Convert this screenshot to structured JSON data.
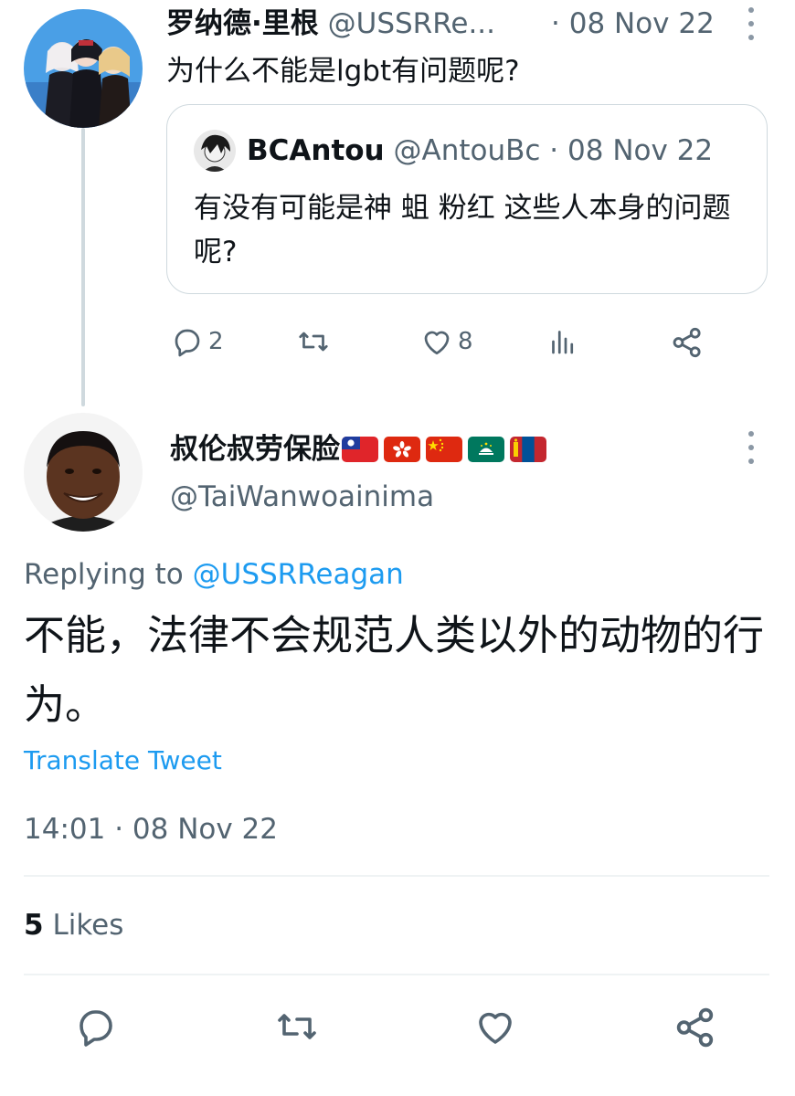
{
  "parent_tweet": {
    "display_name": "罗纳德·里根",
    "handle": "@USSRRe...",
    "dot": "·",
    "date": "08 Nov 22",
    "text": "为什么不能是lgbt有问题呢?",
    "avatar_icon": "anime-group-avatar",
    "quote": {
      "display_name": "BCAntou",
      "handle": "@AntouBc",
      "dot": "·",
      "date": "08 Nov 22",
      "text": "有没有可能是神 蛆 粉红 这些人本身的问题呢?"
    },
    "actions": {
      "reply_count": "2",
      "retweet_count": "",
      "like_count": "8"
    }
  },
  "main_tweet": {
    "display_name": "叔伦叔劳保脸",
    "flags": [
      "flag-taiwan-icon",
      "flag-hongkong-icon",
      "flag-china-icon",
      "flag-macau-icon",
      "flag-mongolia-icon"
    ],
    "handle": "@TaiWanwoainima",
    "replying_prefix": "Replying to",
    "replying_to": "@USSRReagan",
    "text": "不能，法律不会规范人类以外的动物的行为。",
    "translate_label": "Translate Tweet",
    "timestamp": "14:01 · 08 Nov 22",
    "likes_count": "5",
    "likes_label": "Likes"
  },
  "colors": {
    "accent": "#1d9bf0",
    "muted": "#536471",
    "border": "#cfd9de",
    "text": "#0f1419"
  }
}
